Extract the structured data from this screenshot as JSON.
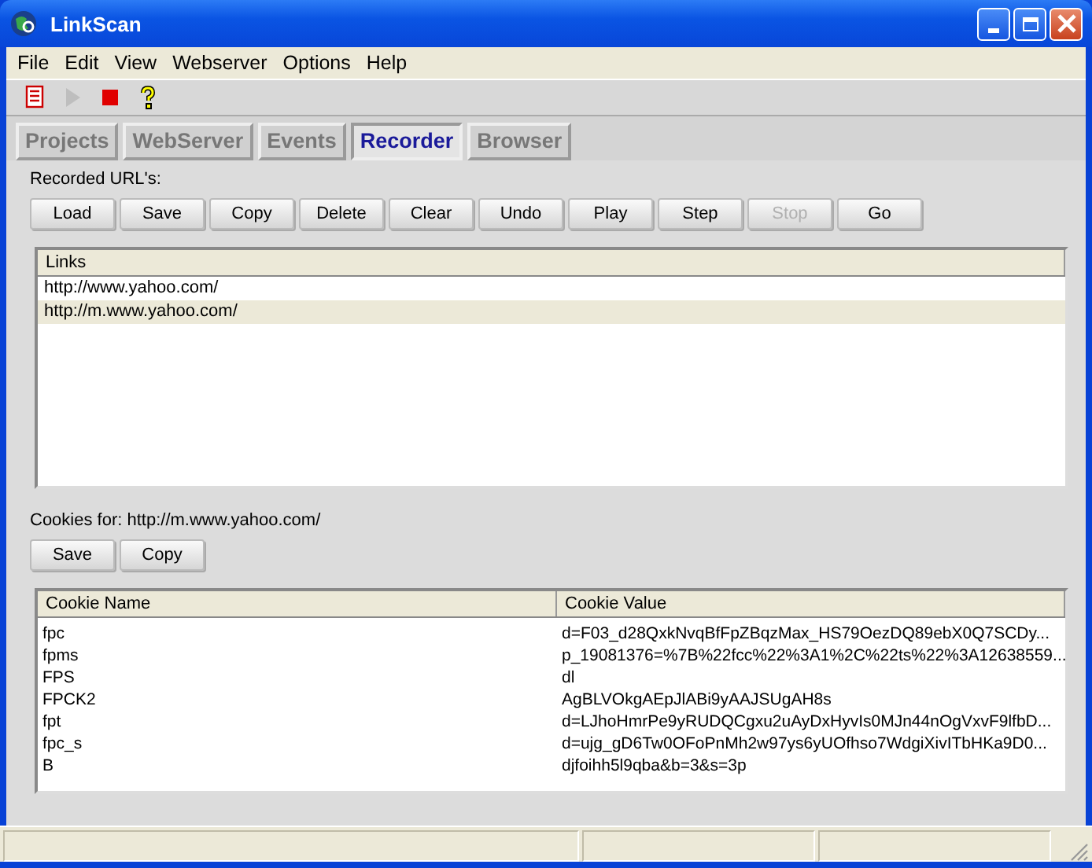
{
  "window": {
    "title": "LinkScan"
  },
  "menu": [
    "File",
    "Edit",
    "View",
    "Webserver",
    "Options",
    "Help"
  ],
  "toolbar": [
    {
      "kind": "list",
      "disabled": false
    },
    {
      "kind": "play",
      "disabled": true
    },
    {
      "kind": "stop",
      "disabled": false
    },
    {
      "kind": "help",
      "disabled": false
    }
  ],
  "tabs": [
    {
      "label": "Projects",
      "selected": false
    },
    {
      "label": "WebServer",
      "selected": false
    },
    {
      "label": "Events",
      "selected": false
    },
    {
      "label": "Recorder",
      "selected": true
    },
    {
      "label": "Browser",
      "selected": false
    }
  ],
  "recorded_label": "Recorded URL's:",
  "url_buttons": [
    {
      "label": "Load",
      "disabled": false
    },
    {
      "label": "Save",
      "disabled": false
    },
    {
      "label": "Copy",
      "disabled": false
    },
    {
      "label": "Delete",
      "disabled": false
    },
    {
      "label": "Clear",
      "disabled": false
    },
    {
      "label": "Undo",
      "disabled": false
    },
    {
      "label": "Play",
      "disabled": false
    },
    {
      "label": "Step",
      "disabled": false
    },
    {
      "label": "Stop",
      "disabled": true
    },
    {
      "label": "Go",
      "disabled": false
    }
  ],
  "links": {
    "column": "Links",
    "rows": [
      {
        "url": "http://www.yahoo.com/",
        "selected": false
      },
      {
        "url": "http://m.www.yahoo.com/",
        "selected": true
      }
    ]
  },
  "cookies_label": "Cookies for: http://m.www.yahoo.com/",
  "cookie_buttons": [
    {
      "label": "Save",
      "disabled": false
    },
    {
      "label": "Copy",
      "disabled": false
    }
  ],
  "cookies": {
    "columns": [
      "Cookie Name",
      "Cookie Value"
    ],
    "rows": [
      [
        "fpc",
        "d=F03_d28QxkNvqBfFpZBqzMax_HS79OezDQ89ebX0Q7SCDy..."
      ],
      [
        "fpms",
        "p_19081376=%7B%22fcc%22%3A1%2C%22ts%22%3A12638559..."
      ],
      [
        "FPS",
        "dl"
      ],
      [
        "FPCK2",
        "AgBLVOkgAEpJlABi9yAAJSUgAH8s"
      ],
      [
        "fpt",
        "d=LJhoHmrPe9yRUDQCgxu2uAyDxHyvIs0MJn44nOgVxvF9lfbD..."
      ],
      [
        "fpc_s",
        "d=ujg_gD6Tw0OFoPnMh2w97ys6yUOfhso7WdgiXivITbHKa9D0..."
      ],
      [
        "B",
        "djfoihh5l9qba&b=3&s=3p"
      ]
    ]
  }
}
